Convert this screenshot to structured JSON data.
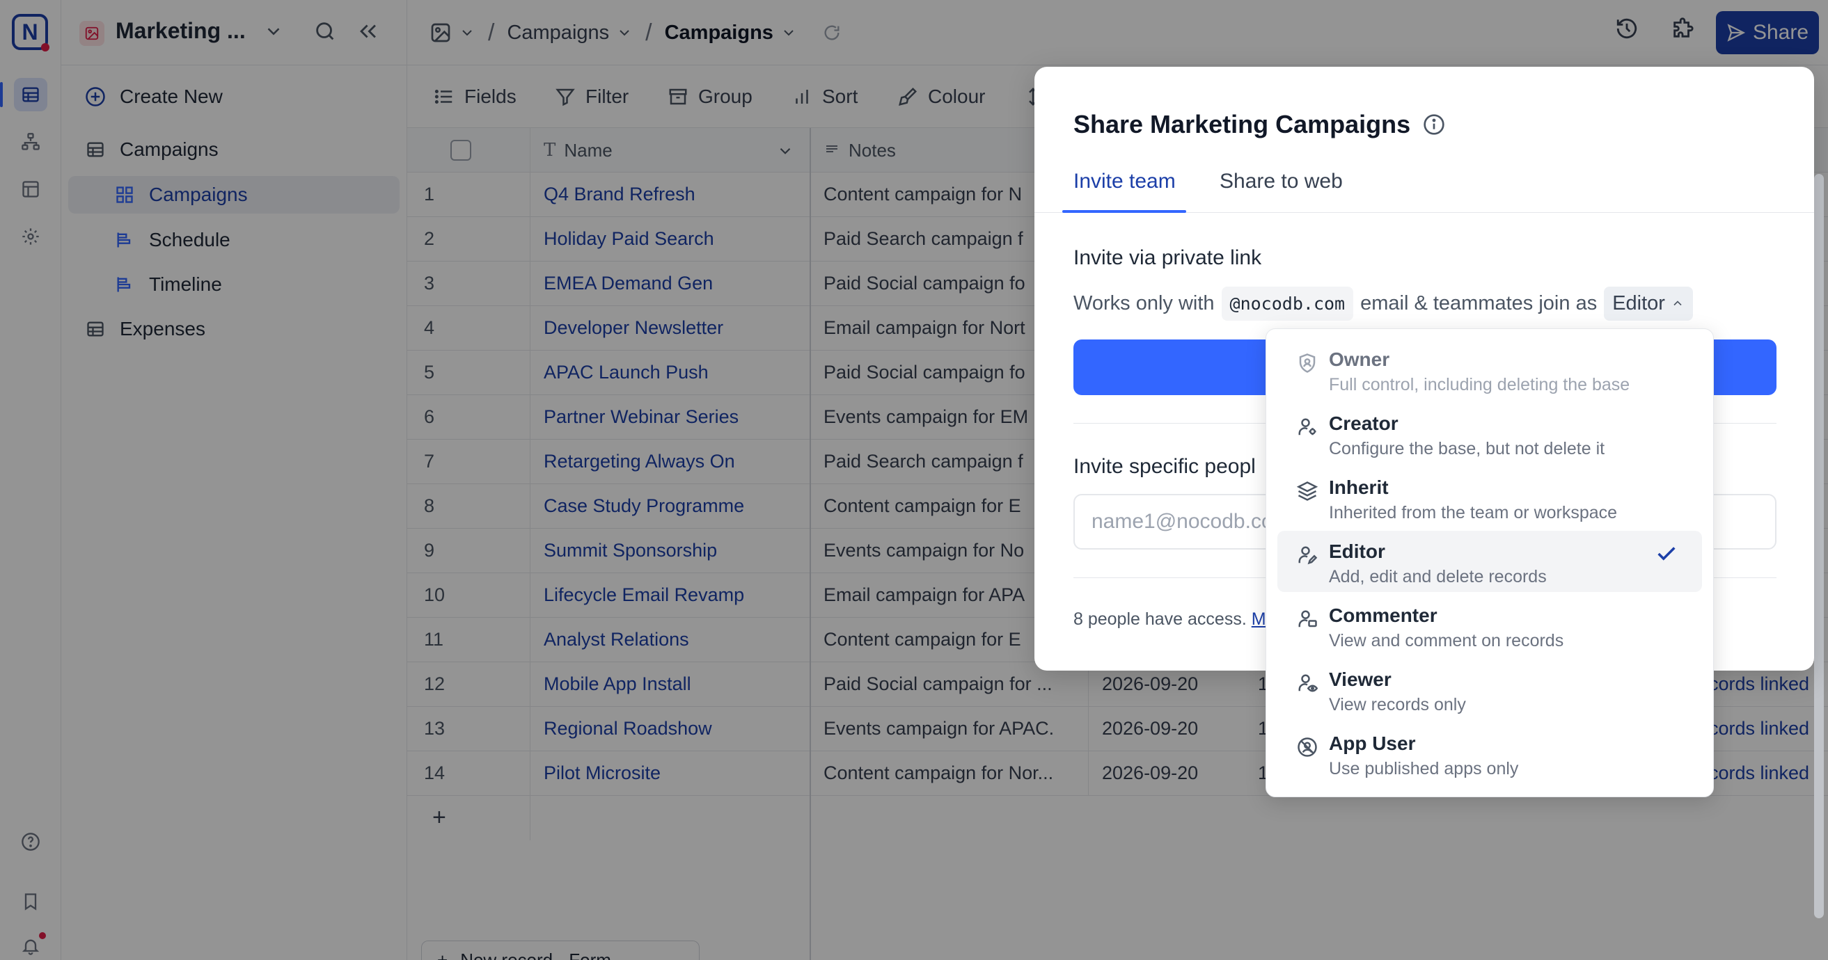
{
  "app": {
    "logo_letter": "N",
    "base_title": "Marketing ..."
  },
  "sidebar": {
    "create_new": "Create New",
    "tables": [
      {
        "label": "Campaigns",
        "views": [
          {
            "label": "Campaigns",
            "type": "gallery",
            "selected": true
          },
          {
            "label": "Schedule",
            "type": "calendar"
          },
          {
            "label": "Timeline",
            "type": "timeline"
          }
        ]
      },
      {
        "label": "Expenses"
      }
    ]
  },
  "header": {
    "crumb1": "Campaigns",
    "crumb2": "Campaigns",
    "share_label": "Share"
  },
  "toolbar": {
    "fields": "Fields",
    "filter": "Filter",
    "group": "Group",
    "sort": "Sort",
    "colour": "Colour"
  },
  "grid": {
    "columns": {
      "name": "Name",
      "notes": "Notes"
    },
    "rows": [
      {
        "n": "1",
        "name": "Q4 Brand Refresh",
        "notes": "Content campaign for N",
        "date": "",
        "num": "",
        "linked": ""
      },
      {
        "n": "2",
        "name": "Holiday Paid Search",
        "notes": "Paid Search campaign f",
        "date": "",
        "num": "",
        "linked": ""
      },
      {
        "n": "3",
        "name": "EMEA Demand Gen",
        "notes": "Paid Social campaign fo",
        "date": "",
        "num": "",
        "linked": ""
      },
      {
        "n": "4",
        "name": "Developer Newsletter",
        "notes": "Email campaign for Nort",
        "date": "",
        "num": "",
        "linked": ""
      },
      {
        "n": "5",
        "name": "APAC Launch Push",
        "notes": "Paid Social campaign fo",
        "date": "",
        "num": "",
        "linked": ""
      },
      {
        "n": "6",
        "name": "Partner Webinar Series",
        "notes": "Events campaign for EM",
        "date": "",
        "num": "",
        "linked": ""
      },
      {
        "n": "7",
        "name": "Retargeting Always On",
        "notes": "Paid Search campaign f",
        "date": "",
        "num": "",
        "linked": ""
      },
      {
        "n": "8",
        "name": "Case Study Programme",
        "notes": "Content campaign for E",
        "date": "",
        "num": "",
        "linked": ""
      },
      {
        "n": "9",
        "name": "Summit Sponsorship",
        "notes": "Events campaign for No",
        "date": "",
        "num": "",
        "linked": ""
      },
      {
        "n": "10",
        "name": "Lifecycle Email Revamp",
        "notes": "Email campaign for APA",
        "date": "",
        "num": "",
        "linked": ""
      },
      {
        "n": "11",
        "name": "Analyst Relations",
        "notes": "Content campaign for E",
        "date": "",
        "num": "",
        "linked": ""
      },
      {
        "n": "12",
        "name": "Mobile App Install",
        "notes": "Paid Social campaign for ...",
        "date": "2026-09-20",
        "num": "1",
        "linked": "cords linked"
      },
      {
        "n": "13",
        "name": "Regional Roadshow",
        "notes": "Events campaign for APAC.",
        "date": "2026-09-20",
        "num": "1",
        "linked": "cords linked"
      },
      {
        "n": "14",
        "name": "Pilot Microsite",
        "notes": "Content campaign for Nor...",
        "date": "2026-09-20",
        "num": "1",
        "linked": "cords linked"
      }
    ],
    "new_record": "New record - Form"
  },
  "modal": {
    "title": "Share Marketing Campaigns",
    "tabs": [
      "Invite team",
      "Share to web"
    ],
    "private_link_title": "Invite via private link",
    "works_only_with": "Works only with",
    "domain": "@nocodb.com",
    "join_as": "email & teammates join as",
    "role": "Editor",
    "specific_title": "Invite specific peopl",
    "email_placeholder": "name1@nocodb.com",
    "access_text": "8 people have access.",
    "access_link": "M"
  },
  "role_menu": [
    {
      "label": "Owner",
      "desc": "Full control, including deleting the base",
      "icon": "shield-user-icon",
      "disabled": true
    },
    {
      "label": "Creator",
      "desc": "Configure the base, but not delete it",
      "icon": "user-gear-icon"
    },
    {
      "label": "Inherit",
      "desc": "Inherited from the team or workspace",
      "icon": "layers-icon"
    },
    {
      "label": "Editor",
      "desc": "Add, edit and delete records",
      "icon": "user-edit-icon",
      "selected": true
    },
    {
      "label": "Commenter",
      "desc": "View and comment on records",
      "icon": "user-comment-icon"
    },
    {
      "label": "Viewer",
      "desc": "View records only",
      "icon": "user-eye-icon"
    },
    {
      "label": "App User",
      "desc": "Use published apps only",
      "icon": "no-user-icon"
    }
  ],
  "colors": {
    "accent": "#3366ff",
    "brand": "#1c3fa8",
    "link": "#1c3fa8"
  }
}
